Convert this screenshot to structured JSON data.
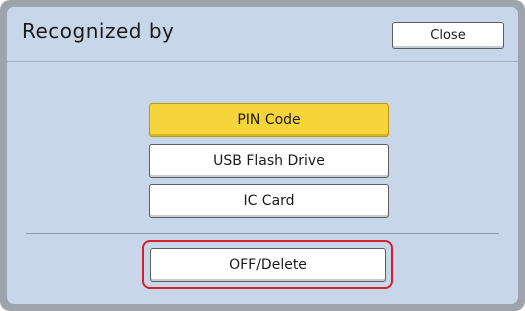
{
  "dialog": {
    "title": "Recognized by",
    "close_label": "Close"
  },
  "options": {
    "pin_code": "PIN Code",
    "usb_flash_drive": "USB Flash Drive",
    "ic_card": "IC Card",
    "selected": "PIN Code"
  },
  "off_delete_label": "OFF/Delete",
  "colors": {
    "panel": "#c8d6ea",
    "frame": "#9ea4ac",
    "selected": "#f6d53b",
    "highlight_ring": "#d71f2a"
  }
}
